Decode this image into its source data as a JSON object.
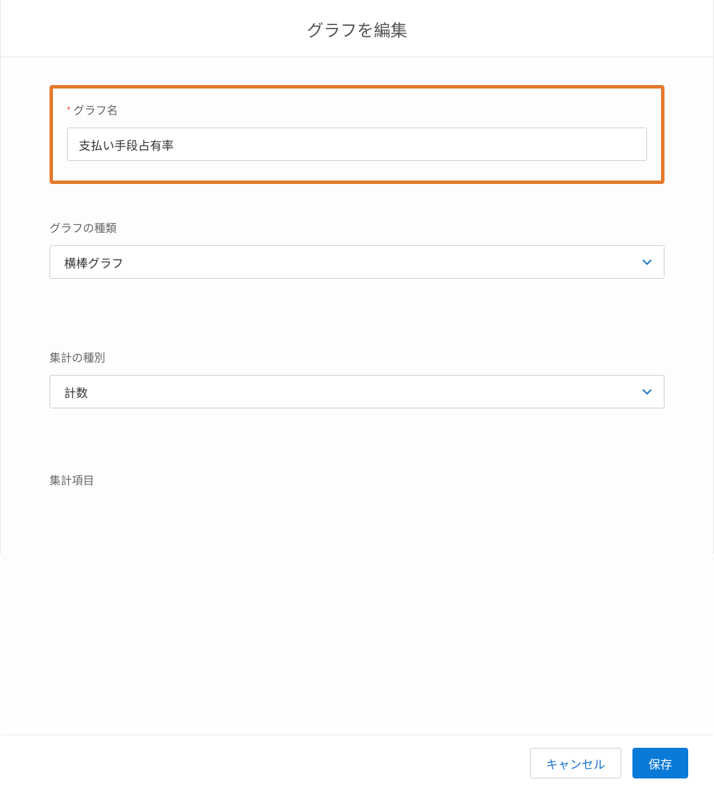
{
  "dialog": {
    "title": "グラフを編集"
  },
  "fields": {
    "name": {
      "label": "グラフ名",
      "required": true,
      "value": "支払い手段占有率"
    },
    "chart_type": {
      "label": "グラフの種類",
      "value": "横棒グラフ"
    },
    "aggregation_type": {
      "label": "集計の種別",
      "value": "計数"
    },
    "aggregation_field": {
      "label": "集計項目"
    }
  },
  "footer": {
    "cancel": "キャンセル",
    "save": "保存"
  },
  "colors": {
    "highlight": "#e47a2e",
    "primary": "#0a7ad8"
  }
}
